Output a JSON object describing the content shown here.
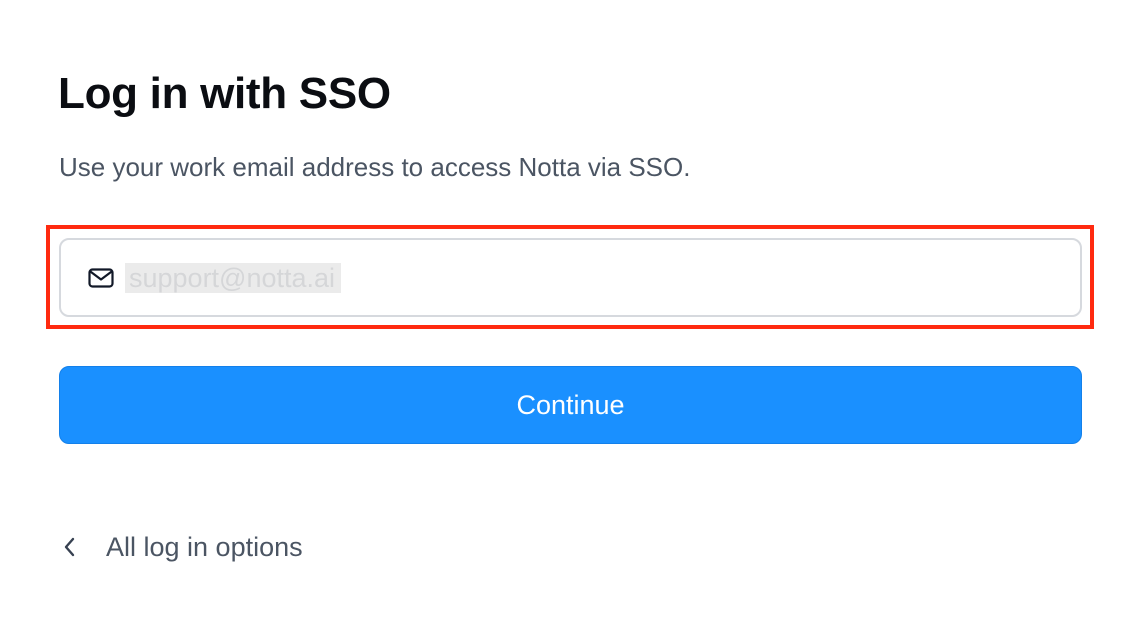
{
  "page": {
    "title": "Log in with SSO",
    "subtitle": "Use your work email address to access Notta via SSO."
  },
  "email_field": {
    "icon": "mail-icon",
    "value": "support@notta.ai"
  },
  "continue_button": {
    "label": "Continue",
    "color": "#1a90ff"
  },
  "back_link": {
    "icon": "chevron-left-icon",
    "label": "All log in options"
  },
  "highlight": {
    "color": "#ff2a10"
  }
}
